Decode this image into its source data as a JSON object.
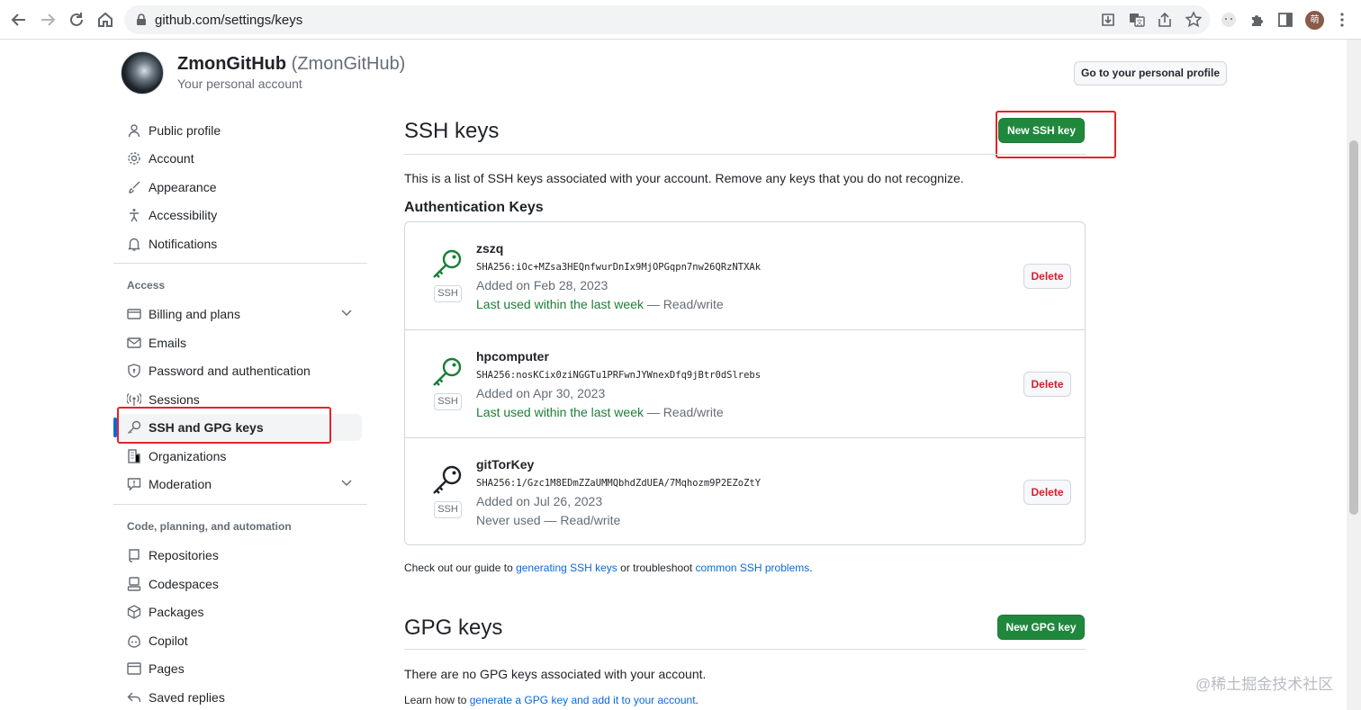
{
  "browser": {
    "url": "github.com/settings/keys",
    "profile_initial": "萌"
  },
  "header": {
    "name": "ZmonGitHub",
    "login": "(ZmonGitHub)",
    "subtitle": "Your personal account",
    "profile_button": "Go to your personal profile"
  },
  "sidebar": {
    "items": [
      {
        "label": "Public profile",
        "icon": "person-icon"
      },
      {
        "label": "Account",
        "icon": "gear-icon"
      },
      {
        "label": "Appearance",
        "icon": "paintbrush-icon"
      },
      {
        "label": "Accessibility",
        "icon": "accessibility-icon"
      },
      {
        "label": "Notifications",
        "icon": "bell-icon"
      }
    ],
    "access_heading": "Access",
    "access_items": [
      {
        "label": "Billing and plans",
        "icon": "credit-card-icon",
        "expandable": true
      },
      {
        "label": "Emails",
        "icon": "mail-icon"
      },
      {
        "label": "Password and authentication",
        "icon": "shield-lock-icon"
      },
      {
        "label": "Sessions",
        "icon": "broadcast-icon"
      },
      {
        "label": "SSH and GPG keys",
        "icon": "key-icon",
        "active": true
      },
      {
        "label": "Organizations",
        "icon": "organization-icon"
      },
      {
        "label": "Moderation",
        "icon": "report-icon",
        "expandable": true
      }
    ],
    "code_heading": "Code, planning, and automation",
    "code_items": [
      {
        "label": "Repositories",
        "icon": "repo-icon"
      },
      {
        "label": "Codespaces",
        "icon": "codespaces-icon"
      },
      {
        "label": "Packages",
        "icon": "package-icon"
      },
      {
        "label": "Copilot",
        "icon": "copilot-icon"
      },
      {
        "label": "Pages",
        "icon": "browser-icon"
      },
      {
        "label": "Saved replies",
        "icon": "reply-icon"
      }
    ]
  },
  "ssh": {
    "title": "SSH keys",
    "new_button": "New SSH key",
    "description": "This is a list of SSH keys associated with your account. Remove any keys that you do not recognize.",
    "auth_heading": "Authentication Keys",
    "keys": [
      {
        "title": "zszq",
        "fingerprint": "SHA256:iOc+MZsa3HEQnfwurDnIx9MjOPGqpn7nw26QRzNTXAk",
        "added": "Added on Feb 28, 2023",
        "used": "Last used within the last week",
        "access": " — Read/write",
        "badge": "SSH",
        "delete": "Delete",
        "recent": true
      },
      {
        "title": "hpcomputer",
        "fingerprint": "SHA256:nosKCix0ziNGGTu1PRFwnJYWnexDfq9jBtr0dSlrebs",
        "added": "Added on Apr 30, 2023",
        "used": "Last used within the last week",
        "access": " — Read/write",
        "badge": "SSH",
        "delete": "Delete",
        "recent": true
      },
      {
        "title": "gitTorKey",
        "fingerprint": "SHA256:1/Gzc1M8EDmZZaUMMQbhdZdUEA/7Mqhozm9P2EZoZtY",
        "added": "Added on Jul 26, 2023",
        "used": "Never used",
        "access": " — Read/write",
        "badge": "SSH",
        "delete": "Delete",
        "recent": false
      }
    ],
    "guide_prefix": "Check out our guide to ",
    "guide_link1": "generating SSH keys",
    "guide_mid": " or troubleshoot ",
    "guide_link2": "common SSH problems",
    "guide_suffix": "."
  },
  "gpg": {
    "title": "GPG keys",
    "new_button": "New GPG key",
    "empty": "There are no GPG keys associated with your account.",
    "learn_prefix": "Learn how to ",
    "learn_link": "generate a GPG key and add it to your account",
    "learn_suffix": "."
  },
  "watermark": "@稀土掘金技术社区",
  "colors": {
    "primary_green": "#1f883d",
    "link_blue": "#0969da",
    "danger_red": "#cf222e",
    "annotation_red": "#e3242b"
  }
}
